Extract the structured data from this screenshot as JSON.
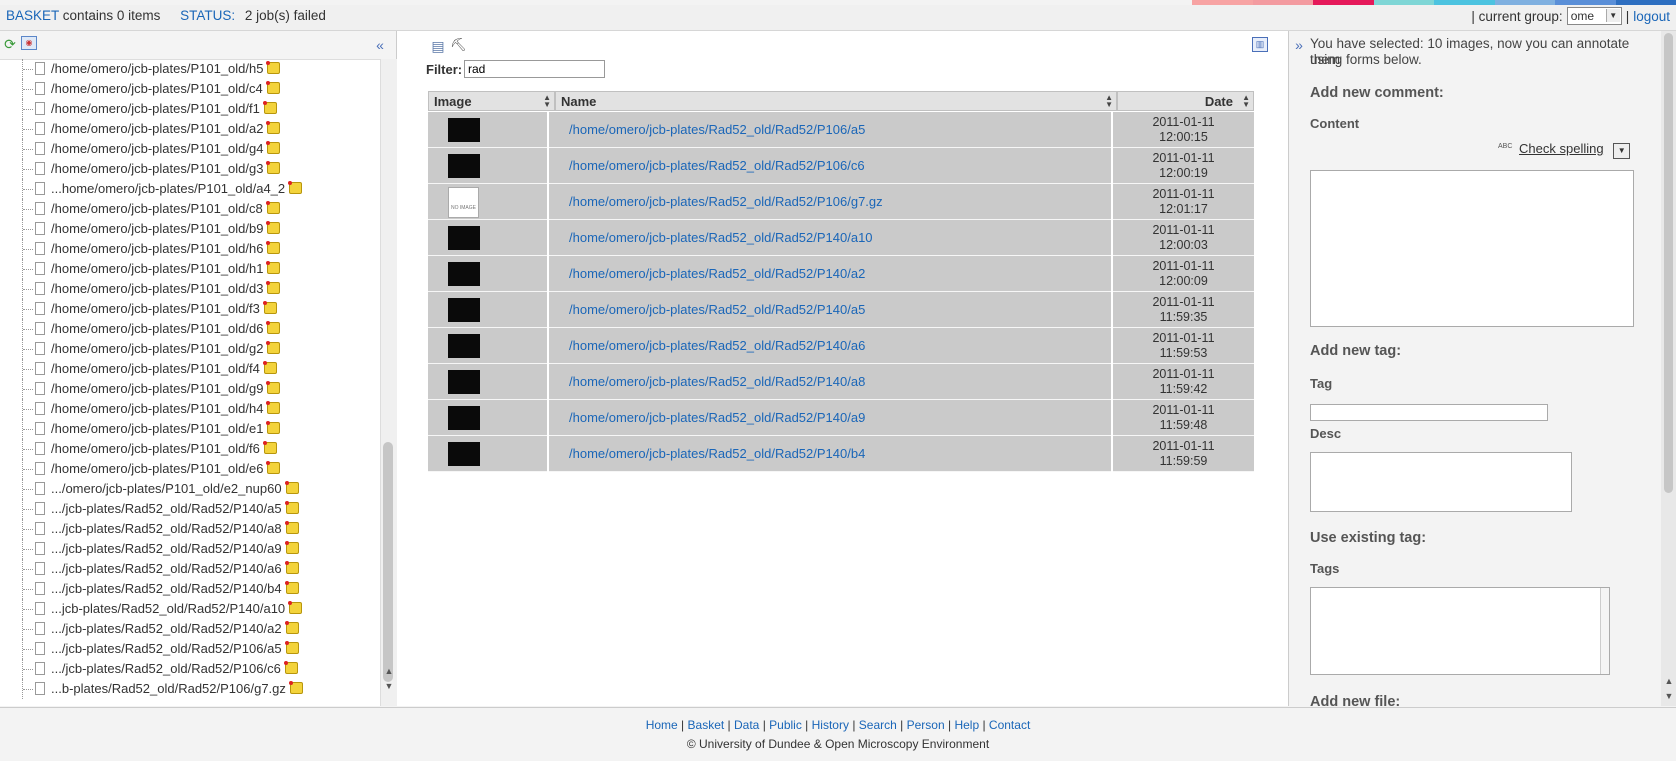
{
  "topbar": {
    "basket_link": "BASKET",
    "basket_text": "contains 0 items",
    "status_label": "STATUS:",
    "status_text": "2 job(s) failed",
    "group_prefix": "| current group:",
    "group_value": "ome",
    "logout_sep": "|",
    "logout": "logout",
    "color_tabs": [
      "#f7a3a3",
      "#f39ba0",
      "#e5195a",
      "#7fd6d6",
      "#4cc3e0",
      "#7fb0e0",
      "#5a8fd8",
      "#2d6ec0"
    ]
  },
  "tree": {
    "items": [
      "/home/omero/jcb-plates/P101_old/h5",
      "/home/omero/jcb-plates/P101_old/c4",
      "/home/omero/jcb-plates/P101_old/f1",
      "/home/omero/jcb-plates/P101_old/a2",
      "/home/omero/jcb-plates/P101_old/g4",
      "/home/omero/jcb-plates/P101_old/g3",
      "...home/omero/jcb-plates/P101_old/a4_2",
      "/home/omero/jcb-plates/P101_old/c8",
      "/home/omero/jcb-plates/P101_old/b9",
      "/home/omero/jcb-plates/P101_old/h6",
      "/home/omero/jcb-plates/P101_old/h1",
      "/home/omero/jcb-plates/P101_old/d3",
      "/home/omero/jcb-plates/P101_old/f3",
      "/home/omero/jcb-plates/P101_old/d6",
      "/home/omero/jcb-plates/P101_old/g2",
      "/home/omero/jcb-plates/P101_old/f4",
      "/home/omero/jcb-plates/P101_old/g9",
      "/home/omero/jcb-plates/P101_old/h4",
      "/home/omero/jcb-plates/P101_old/e1",
      "/home/omero/jcb-plates/P101_old/f6",
      "/home/omero/jcb-plates/P101_old/e6",
      ".../omero/jcb-plates/P101_old/e2_nup60",
      ".../jcb-plates/Rad52_old/Rad52/P140/a5",
      ".../jcb-plates/Rad52_old/Rad52/P140/a8",
      ".../jcb-plates/Rad52_old/Rad52/P140/a9",
      ".../jcb-plates/Rad52_old/Rad52/P140/a6",
      ".../jcb-plates/Rad52_old/Rad52/P140/b4",
      "...jcb-plates/Rad52_old/Rad52/P140/a10",
      ".../jcb-plates/Rad52_old/Rad52/P140/a2",
      ".../jcb-plates/Rad52_old/Rad52/P106/a5",
      ".../jcb-plates/Rad52_old/Rad52/P106/c6",
      "...b-plates/Rad52_old/Rad52/P106/g7.gz"
    ]
  },
  "filter": {
    "label": "Filter:",
    "value": "rad"
  },
  "grid": {
    "headers": {
      "image": "Image",
      "name": "Name",
      "date": "Date"
    },
    "no_image_text": "NO IMAGE",
    "rows": [
      {
        "name": "/home/omero/jcb-plates/Rad52_old/Rad52/P106/a5",
        "date": "2011-01-11",
        "time": "12:00:15",
        "has_image": true
      },
      {
        "name": "/home/omero/jcb-plates/Rad52_old/Rad52/P106/c6",
        "date": "2011-01-11",
        "time": "12:00:19",
        "has_image": true
      },
      {
        "name": "/home/omero/jcb-plates/Rad52_old/Rad52/P106/g7.gz",
        "date": "2011-01-11",
        "time": "12:01:17",
        "has_image": false
      },
      {
        "name": "/home/omero/jcb-plates/Rad52_old/Rad52/P140/a10",
        "date": "2011-01-11",
        "time": "12:00:03",
        "has_image": true
      },
      {
        "name": "/home/omero/jcb-plates/Rad52_old/Rad52/P140/a2",
        "date": "2011-01-11",
        "time": "12:00:09",
        "has_image": true
      },
      {
        "name": "/home/omero/jcb-plates/Rad52_old/Rad52/P140/a5",
        "date": "2011-01-11",
        "time": "11:59:35",
        "has_image": true
      },
      {
        "name": "/home/omero/jcb-plates/Rad52_old/Rad52/P140/a6",
        "date": "2011-01-11",
        "time": "11:59:53",
        "has_image": true
      },
      {
        "name": "/home/omero/jcb-plates/Rad52_old/Rad52/P140/a8",
        "date": "2011-01-11",
        "time": "11:59:42",
        "has_image": true
      },
      {
        "name": "/home/omero/jcb-plates/Rad52_old/Rad52/P140/a9",
        "date": "2011-01-11",
        "time": "11:59:48",
        "has_image": true
      },
      {
        "name": "/home/omero/jcb-plates/Rad52_old/Rad52/P140/b4",
        "date": "2011-01-11",
        "time": "11:59:59",
        "has_image": true
      }
    ]
  },
  "annotate": {
    "selected_text_1": "You have selected: 10 images, now you can annotate them",
    "selected_text_2": "using forms below.",
    "comment_heading": "Add new comment:",
    "content_label": "Content",
    "spell_icon": "ABC",
    "check_spelling": "Check spelling",
    "tag_heading": "Add new tag:",
    "tag_label": "Tag",
    "desc_label": "Desc",
    "existing_heading": "Use existing tag:",
    "tags_label": "Tags",
    "file_heading": "Add new file:"
  },
  "footer": {
    "links": [
      "Home",
      "Basket",
      "Data",
      "Public",
      "History",
      "Search",
      "Person",
      "Help",
      "Contact"
    ],
    "copyright": "© University of Dundee & Open Microscopy Environment"
  }
}
